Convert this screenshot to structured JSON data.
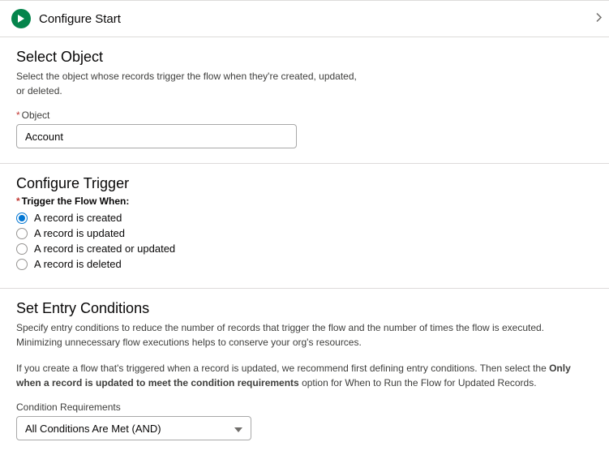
{
  "header": {
    "title": "Configure Start"
  },
  "selectObject": {
    "title": "Select Object",
    "desc": "Select the object whose records trigger the flow when they're created, updated, or deleted.",
    "label": "Object",
    "value": "Account"
  },
  "configureTrigger": {
    "title": "Configure Trigger",
    "label": "Trigger the Flow When:",
    "options": [
      "A record is created",
      "A record is updated",
      "A record is created or updated",
      "A record is deleted"
    ],
    "selectedIndex": 0
  },
  "entryConditions": {
    "title": "Set Entry Conditions",
    "desc1": "Specify entry conditions to reduce the number of records that trigger the flow and the number of times the flow is executed. Minimizing unnecessary flow executions helps to conserve your org's resources.",
    "desc2a": "If you create a flow that's triggered when a record is updated, we recommend first defining entry conditions. Then select the ",
    "desc2bold": "Only when a record is updated to meet the condition requirements",
    "desc2b": " option for When to Run the Flow for Updated Records.",
    "conditionLabel": "Condition Requirements",
    "conditionValue": "All Conditions Are Met (AND)"
  }
}
